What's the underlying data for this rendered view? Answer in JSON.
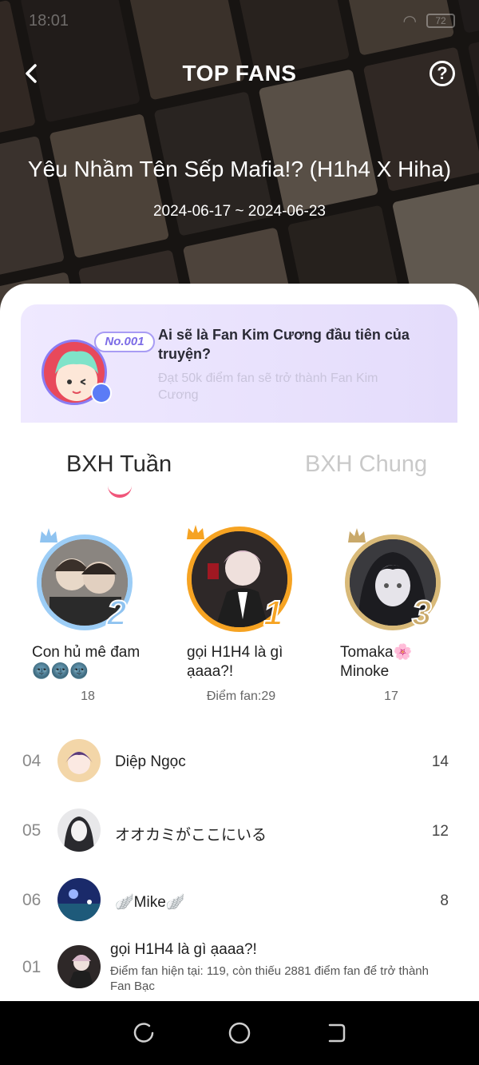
{
  "status_bar": {
    "time": "18:01",
    "battery": "72"
  },
  "header": {
    "title": "TOP FANS",
    "comic_title": "Yêu Nhầm Tên Sếp Mafia!? (H1h4 X Hiha)",
    "date_range": "2024-06-17 ~ 2024-06-23",
    "back_icon": "chevron-left-icon",
    "help_icon": "question-circle-icon"
  },
  "banner": {
    "badge": "No.001",
    "title": "Ai sẽ là Fan Kim Cương đầu tiên của truyện?",
    "subtitle": "Đạt 50k điểm fan sẽ trở thành Fan Kim Cương"
  },
  "tabs": {
    "weekly": "BXH Tuần",
    "overall": "BXH Chung",
    "active": "weekly"
  },
  "podium": [
    {
      "rank": "2",
      "name": "Con hủ mê đam 🌚🌚🌚",
      "score": "18",
      "ring_color": "#9ccdf6",
      "rank_color": "#8fc3f0"
    },
    {
      "rank": "1",
      "name": "gọi H1H4 là gì ạaaa?!",
      "score": "Điểm fan:29",
      "ring_color": "#f6a322",
      "rank_color": "#f6a322"
    },
    {
      "rank": "3",
      "name": "Tomaka🌸 Minoke",
      "score": "17",
      "ring_color": "#d8b978",
      "rank_color": "#c9a96a"
    }
  ],
  "list": [
    {
      "rank": "04",
      "name": "Diệp Ngọc",
      "score": "14"
    },
    {
      "rank": "05",
      "name": "オオカミがここにいる",
      "score": "12"
    },
    {
      "rank": "06",
      "name": "🪽Mike🪽",
      "score": "8"
    }
  ],
  "my_rank": {
    "rank": "01",
    "name": "gọi H1H4 là gì ạaaa?!",
    "description": "Điểm fan hiện tại: 119, còn thiếu 2881 điểm fan để trở thành Fan Bạc"
  },
  "colors": {
    "accent": "#f0567a",
    "banner_bg": "#e8e2fb",
    "gold": "#f6a322"
  }
}
